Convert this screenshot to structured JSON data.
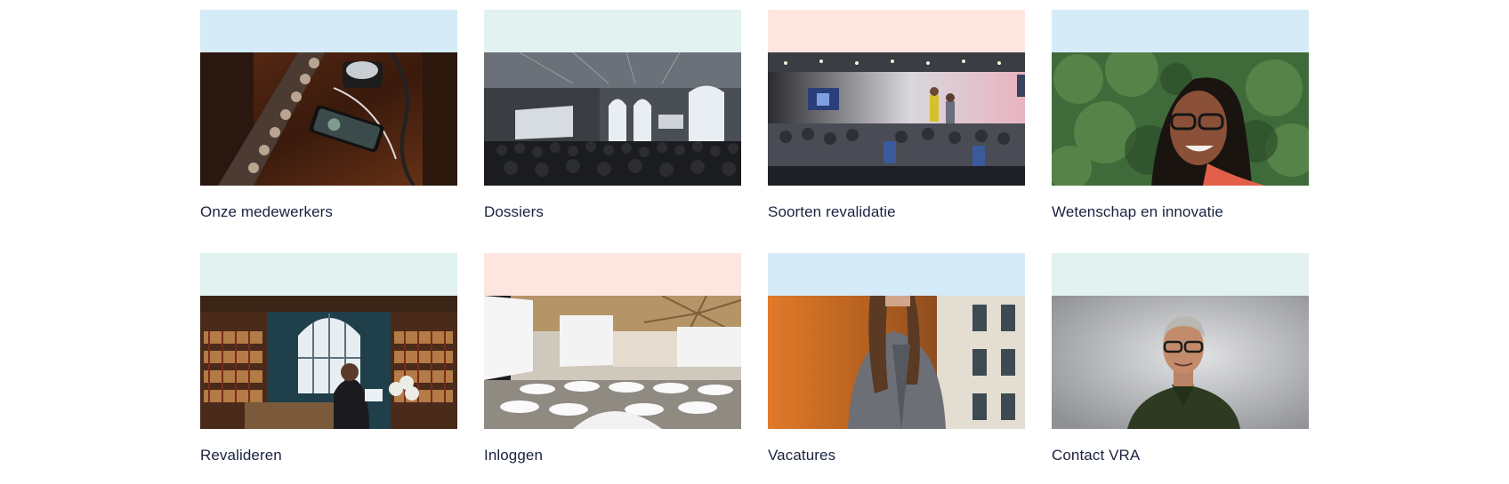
{
  "colors": {
    "band_blue": "#d5ebf7",
    "band_mint": "#e1f2f0",
    "band_peach": "#fde6e0",
    "title_text": "#1b2240"
  },
  "cards": [
    {
      "title": "Onze medewerkers",
      "band": "blue",
      "photo": "audio-mixer-with-smartphone"
    },
    {
      "title": "Dossiers",
      "band": "mint",
      "photo": "conference-hall-audience"
    },
    {
      "title": "Soorten revalidatie",
      "band": "peach",
      "photo": "event-room-with-speakers"
    },
    {
      "title": "Wetenschap en innovatie",
      "band": "blue",
      "photo": "smiling-woman-with-glasses"
    },
    {
      "title": "Revalideren",
      "band": "mint",
      "photo": "bookstore-interior"
    },
    {
      "title": "Inloggen",
      "band": "peach",
      "photo": "round-table-auditorium"
    },
    {
      "title": "Vacatures",
      "band": "blue",
      "photo": "woman-in-grey-blazer"
    },
    {
      "title": "Contact VRA",
      "band": "mint",
      "photo": "man-with-glasses-portrait"
    }
  ]
}
